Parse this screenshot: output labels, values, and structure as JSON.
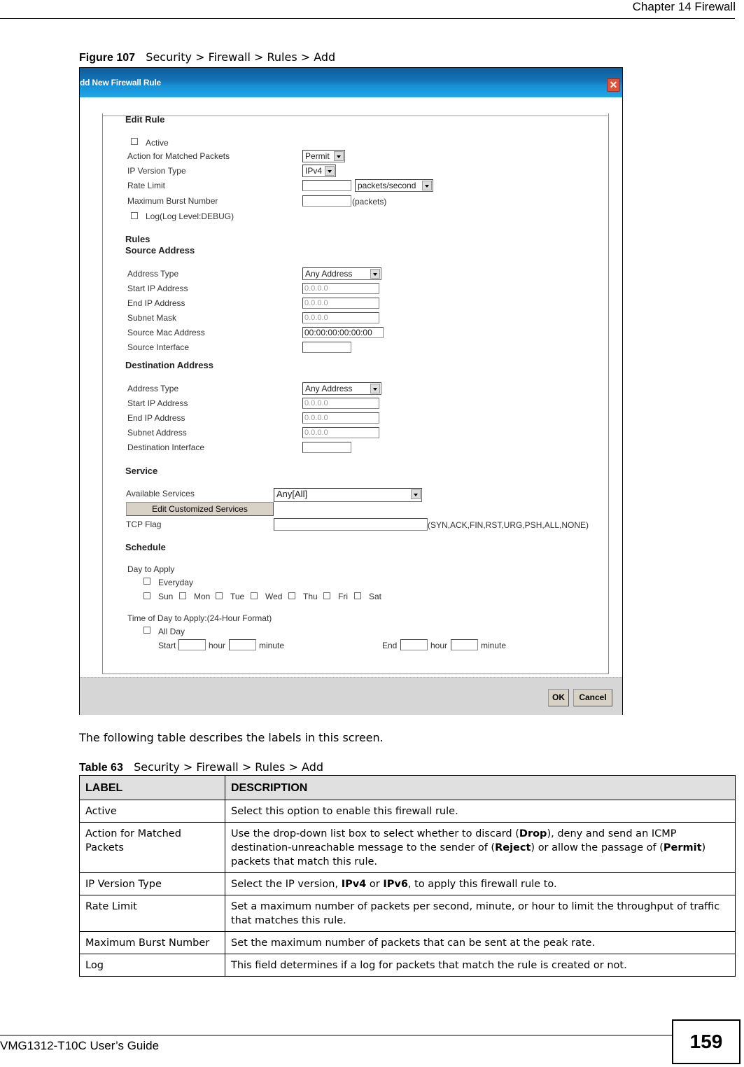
{
  "page_header": {
    "chapter": "Chapter 14 Firewall"
  },
  "figure": {
    "number": "Figure 107",
    "title": "Security > Firewall > Rules > Add"
  },
  "dialog": {
    "title": "dd New Firewall Rule",
    "close_icon": "close-icon",
    "edit_rule": {
      "heading": "Edit Rule",
      "active_label": "Active",
      "active_checked": false,
      "action_label": "Action for Matched Packets",
      "action_value": "Permit",
      "ip_version_label": "IP Version Type",
      "ip_version_value": "IPv4",
      "rate_limit_label": "Rate Limit",
      "rate_limit_value": "",
      "rate_unit_value": "packets/second",
      "burst_label": "Maximum Burst Number",
      "burst_value": "",
      "burst_unit": "(packets)",
      "log_label": "Log(Log Level:DEBUG)",
      "log_checked": false
    },
    "rules_heading": "Rules",
    "source": {
      "heading": "Source Address",
      "address_type_label": "Address Type",
      "address_type_value": "Any Address",
      "start_ip_label": "Start IP Address",
      "start_ip_value": "0.0.0.0",
      "end_ip_label": "End IP Address",
      "end_ip_value": "0.0.0.0",
      "subnet_label": "Subnet Mask",
      "subnet_value": "0.0.0.0",
      "mac_label": "Source Mac Address",
      "mac_value": "00:00:00:00:00:00",
      "interface_label": "Source Interface",
      "interface_value": ""
    },
    "destination": {
      "heading": "Destination Address",
      "address_type_label": "Address Type",
      "address_type_value": "Any Address",
      "start_ip_label": "Start IP Address",
      "start_ip_value": "0.0.0.0",
      "end_ip_label": "End IP Address",
      "end_ip_value": "0.0.0.0",
      "subnet_label": "Subnet Address",
      "subnet_value": "0.0.0.0",
      "interface_label": "Destination Interface",
      "interface_value": ""
    },
    "service": {
      "heading": "Service",
      "available_label": "Available Services",
      "available_value": "Any[All]",
      "edit_button": "Edit Customized Services",
      "tcp_flag_label": "TCP Flag",
      "tcp_flag_value": "",
      "tcp_flag_hint": "(SYN,ACK,FIN,RST,URG,PSH,ALL,NONE)"
    },
    "schedule": {
      "heading": "Schedule",
      "day_label": "Day to Apply",
      "everyday_label": "Everyday",
      "days": [
        "Sun",
        "Mon",
        "Tue",
        "Wed",
        "Thu",
        "Fri",
        "Sat"
      ],
      "time_label": "Time of Day to Apply:(24-Hour Format)",
      "all_day_label": "All Day",
      "start_label": "Start",
      "end_label": "End",
      "hour_label": "hour",
      "minute_label": "minute"
    },
    "ok_button": "OK",
    "cancel_button": "Cancel"
  },
  "intro_text": "The following table describes the labels in this screen.",
  "table": {
    "number": "Table 63",
    "title": "Security > Firewall > Rules > Add",
    "headers": [
      "LABEL",
      "DESCRIPTION"
    ],
    "rows": [
      {
        "label": "Active",
        "description": "Select this option to enable this firewall rule."
      },
      {
        "label": "Action for Matched Packets",
        "description_parts": [
          "Use the drop-down list box to select whether to discard (",
          "Drop",
          "), deny and send an ICMP destination-unreachable message to the sender of (",
          "Reject",
          ") or allow the passage of (",
          "Permit",
          ") packets that match this rule."
        ]
      },
      {
        "label": "IP Version Type",
        "description_parts": [
          "Select the IP version, ",
          "IPv4",
          " or ",
          "IPv6",
          ", to apply this firewall rule to."
        ]
      },
      {
        "label": "Rate Limit",
        "description": "Set a maximum number of packets per second, minute, or hour to limit the throughput of traffic that matches this rule."
      },
      {
        "label": "Maximum Burst Number",
        "description": "Set the maximum number of packets that can be sent at the peak rate."
      },
      {
        "label": "Log",
        "description": "This field determines if a log for packets that match the rule is created or not."
      }
    ]
  },
  "page_footer": {
    "guide": "VMG1312-T10C User’s Guide",
    "page_number": "159"
  }
}
